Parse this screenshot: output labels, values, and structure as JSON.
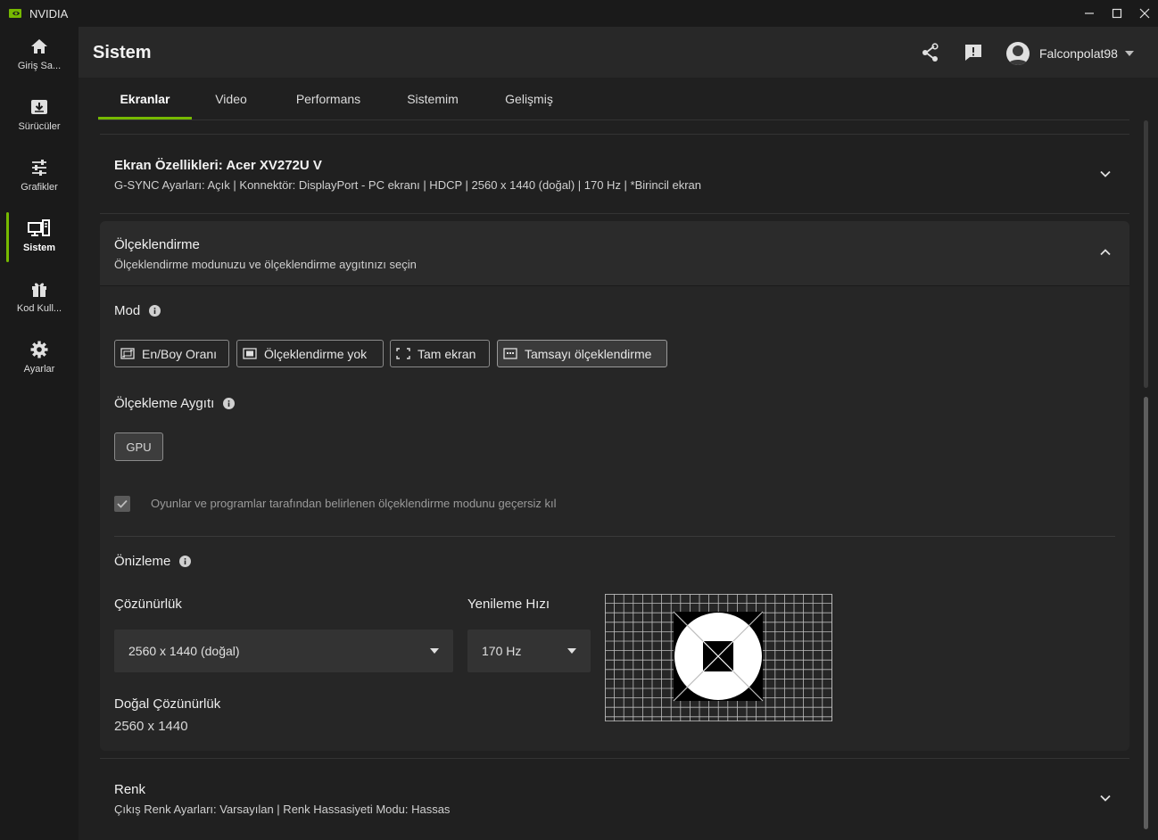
{
  "window": {
    "title": "NVIDIA"
  },
  "sidebar": {
    "items": [
      {
        "label": "Giriş Sa...",
        "icon": "home-icon"
      },
      {
        "label": "Sürücüler",
        "icon": "download-icon"
      },
      {
        "label": "Grafikler",
        "icon": "sliders-icon"
      },
      {
        "label": "Sistem",
        "icon": "system-icon",
        "active": true
      },
      {
        "label": "Kod Kull...",
        "icon": "gift-icon"
      },
      {
        "label": "Ayarlar",
        "icon": "gear-icon"
      }
    ]
  },
  "header": {
    "title": "Sistem",
    "username": "Falconpolat98"
  },
  "tabs": [
    {
      "label": "Ekranlar",
      "active": true
    },
    {
      "label": "Video"
    },
    {
      "label": "Performans"
    },
    {
      "label": "Sistemim"
    },
    {
      "label": "Gelişmiş"
    }
  ],
  "display_card": {
    "title": "Ekran Özellikleri: Acer XV272U V",
    "subtitle": "G-SYNC Ayarları: Açık | Konnektör: DisplayPort - PC ekranı | HDCP | 2560 x 1440 (doğal) | 170 Hz | *Birincil ekran"
  },
  "scaling_card": {
    "title": "Ölçeklendirme",
    "subtitle": "Ölçeklendirme modunuzu ve ölçeklendirme aygıtınızı seçin",
    "mode_label": "Mod",
    "modes": [
      {
        "label": "En/Boy Oranı",
        "icon": "aspect-ratio-icon"
      },
      {
        "label": "Ölçeklendirme yok",
        "icon": "no-scaling-icon"
      },
      {
        "label": "Tam ekran",
        "icon": "fullscreen-icon"
      },
      {
        "label": "Tamsayı ölçeklendirme",
        "icon": "integer-scaling-icon",
        "selected": true
      }
    ],
    "device_label": "Ölçekleme Aygıtı",
    "device_value": "GPU",
    "override_label": "Oyunlar ve programlar tarafından belirlenen ölçeklendirme modunu geçersiz kıl",
    "override_checked": true,
    "preview_label": "Önizleme",
    "resolution_label": "Çözünürlük",
    "resolution_value": "2560 x 1440 (doğal)",
    "refresh_label": "Yenileme Hızı",
    "refresh_value": "170 Hz",
    "native_label": "Doğal Çözünürlük",
    "native_value": "2560 x 1440"
  },
  "color_card": {
    "title": "Renk",
    "subtitle": "Çıkış Renk Ayarları: Varsayılan | Renk Hassasiyeti Modu: Hassas"
  },
  "colors": {
    "accent": "#76b900",
    "background": "#202020",
    "panel": "#262626"
  }
}
